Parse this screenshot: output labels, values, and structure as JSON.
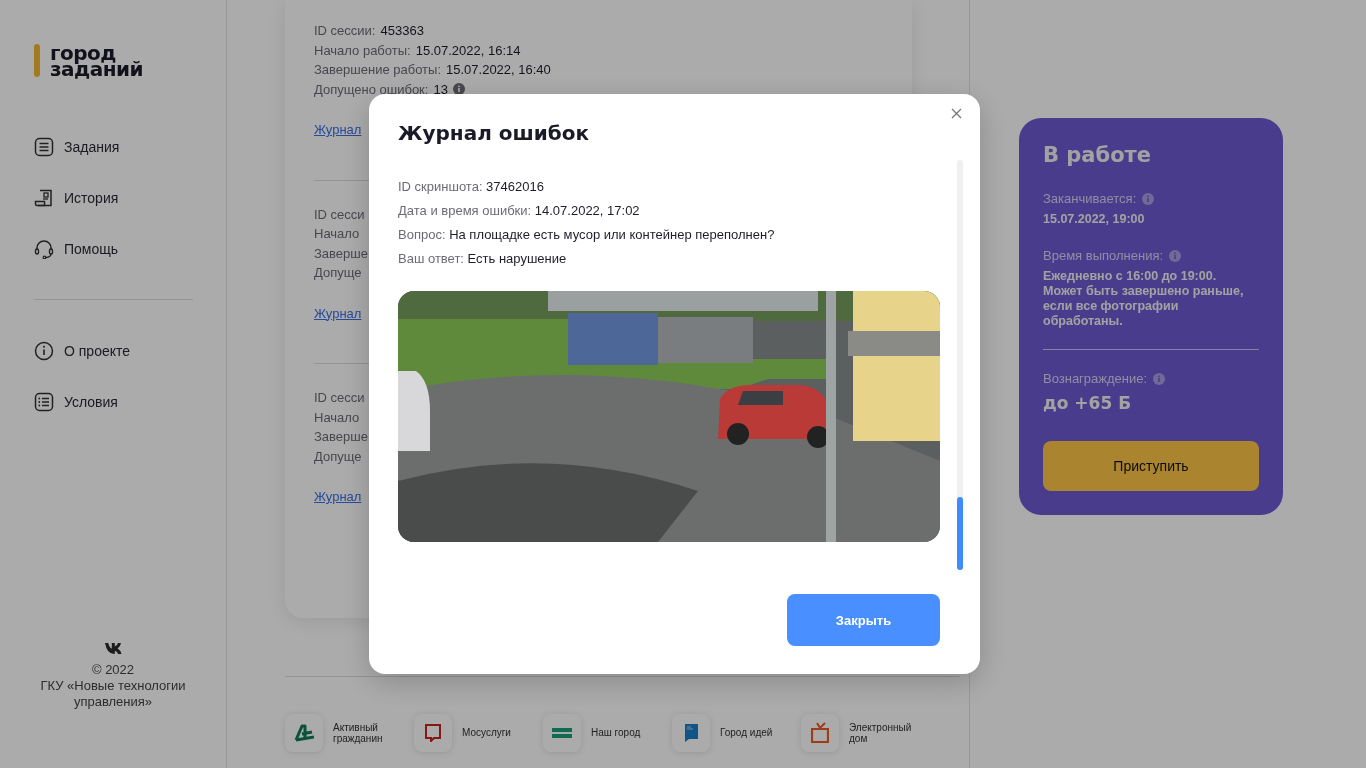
{
  "sidebar": {
    "logo_lines": [
      "город",
      "заданий"
    ],
    "nav": [
      {
        "label": "Задания"
      },
      {
        "label": "История"
      },
      {
        "label": "Помощь"
      }
    ],
    "nav_secondary": [
      {
        "label": "О проекте"
      },
      {
        "label": "Условия"
      }
    ],
    "copyright": "© 2022",
    "organization": "ГКУ «Новые технологии управления»"
  },
  "sessions": [
    {
      "lines": [
        {
          "label": "ID сессии:",
          "value": "453363"
        },
        {
          "label": "Начало работы:",
          "value": "15.07.2022, 16:14"
        },
        {
          "label": "Завершение работы:",
          "value": "15.07.2022, 16:40"
        },
        {
          "label": "Допущено ошибок:",
          "value": "13",
          "info": true
        }
      ],
      "link": "Журнал"
    },
    {
      "lines": [
        {
          "label": "ID сесси"
        },
        {
          "label": "Начало"
        },
        {
          "label": "Заверше"
        },
        {
          "label": "Допуще"
        }
      ],
      "link": "Журнал"
    },
    {
      "lines": [
        {
          "label": "ID сесси"
        },
        {
          "label": "Начало"
        },
        {
          "label": "Заверше"
        },
        {
          "label": "Допуще"
        }
      ],
      "link": "Журнал"
    }
  ],
  "status_card": {
    "title": "В работе",
    "fields": [
      {
        "label": "Заканчивается:",
        "value": "15.07.2022, 19:00"
      },
      {
        "label": "Время выполнения:",
        "value": "Ежедневно с 16:00 до 19:00. Может быть завершено раньше, если все фотографии обработаны."
      }
    ],
    "reward": {
      "label": "Вознаграждение:",
      "value": "до +65 Б"
    },
    "button": "Приступить"
  },
  "partners": [
    {
      "label": "Активный гражданин"
    },
    {
      "label": "Мосуслуги"
    },
    {
      "label": "Наш город"
    },
    {
      "label": "Город идей"
    },
    {
      "label": "Электронный дом"
    }
  ],
  "modal": {
    "title": "Журнал ошибок",
    "fields": [
      {
        "label": "ID скриншота:",
        "value": "37462016"
      },
      {
        "label": "Дата и время ошибки:",
        "value": "14.07.2022, 17:02"
      },
      {
        "label": "Вопрос:",
        "value": "На площадке есть мусор или контейнер переполнен?"
      },
      {
        "label": "Ваш ответ:",
        "value": "Есть нарушение"
      }
    ],
    "button": "Закрыть"
  }
}
